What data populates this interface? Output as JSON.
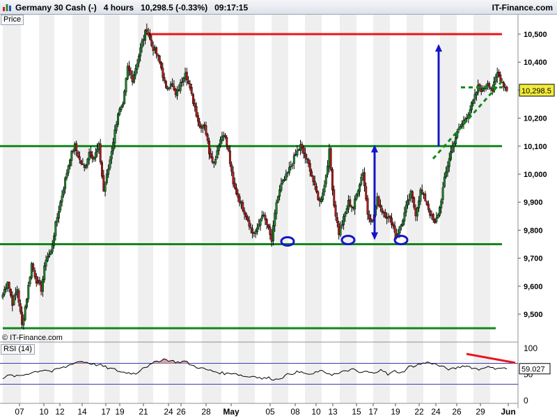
{
  "header": {
    "title": "Germany 30 Cash (-)   4 hours   10,298.5 (-0.33%)   09:17:15",
    "brand": "IT-Finance.com",
    "logo_icon": "chart-bars-icon"
  },
  "panels": {
    "price_label": "Price",
    "rsi_label": "RSI (14)",
    "copyright": "© IT-Finance.com"
  },
  "chart_data": [
    {
      "type": "candlestick",
      "title": "Germany 30 Cash (-)",
      "timeframe": "4 hours",
      "last_price": "10,298.5",
      "change": "-0.33%",
      "time": "09:17:15",
      "y_ticks": [
        "10,500",
        "10,400",
        "10,300",
        "10,200",
        "10,100",
        "10,000",
        "9,900",
        "9,800",
        "9,700",
        "9,600",
        "9,500"
      ],
      "y_tick_values": [
        10500,
        10400,
        10300,
        10200,
        10100,
        10000,
        9900,
        9800,
        9700,
        9600,
        9500
      ],
      "ylim": [
        9440,
        10560
      ],
      "x_ticks": [
        "07",
        "10",
        "12",
        "14",
        "17",
        "19",
        "21",
        "24",
        "26",
        "28",
        "May",
        "05",
        "08",
        "10",
        "13",
        "15",
        "17",
        "19",
        "22",
        "24",
        "26",
        "29",
        "Jun"
      ],
      "last_price_label": "10,298.5",
      "close_path": [
        9570,
        9620,
        9540,
        9590,
        9460,
        9560,
        9680,
        9620,
        9590,
        9700,
        9720,
        9820,
        9900,
        9980,
        10060,
        10100,
        10050,
        10020,
        10080,
        10060,
        10100,
        9940,
        10020,
        10120,
        10220,
        10240,
        10380,
        10340,
        10400,
        10470,
        10520,
        10460,
        10430,
        10380,
        10300,
        10330,
        10280,
        10320,
        10370,
        10300,
        10240,
        10170,
        10180,
        10080,
        10040,
        10110,
        10150,
        10080,
        9960,
        9920,
        9880,
        9840,
        9790,
        9800,
        9860,
        9820,
        9760,
        9900,
        9960,
        9990,
        10030,
        10070,
        10100,
        10060,
        10020,
        9950,
        9900,
        9960,
        10080,
        9890,
        9790,
        9840,
        9900,
        9880,
        9950,
        10010,
        9860,
        9830,
        9910,
        9870,
        9850,
        9830,
        9780,
        9820,
        9880,
        9930,
        9860,
        9940,
        9910,
        9860,
        9820,
        9880,
        9980,
        10060,
        10120,
        10160,
        10190,
        10220,
        10260,
        10310,
        10300,
        10330,
        10300,
        10360,
        10330,
        10298.5
      ],
      "horizontal_levels": [
        {
          "value": 10500,
          "color": "#e8161b",
          "style": "resistance"
        },
        {
          "value": 10100,
          "color": "#12861c",
          "style": "support"
        },
        {
          "value": 9750,
          "color": "#12861c",
          "style": "support"
        },
        {
          "value": 9450,
          "color": "#12861c",
          "style": "support"
        }
      ],
      "annotations": [
        {
          "kind": "up-arrow",
          "from": 10100,
          "to": 10460,
          "color": "#1515c8"
        },
        {
          "kind": "double-arrow",
          "from": 9770,
          "to": 10100,
          "color": "#1515c8"
        },
        {
          "kind": "circle",
          "value": 9760,
          "color": "#1515c8"
        },
        {
          "kind": "circle",
          "value": 9765,
          "color": "#1515c8"
        },
        {
          "kind": "circle",
          "value": 9765,
          "color": "#1515c8"
        },
        {
          "kind": "dashed-trendline",
          "from": 10055,
          "to": 10335,
          "color": "#12861c"
        }
      ]
    },
    {
      "type": "line",
      "title": "RSI (14)",
      "y_ticks": [
        "100",
        "50",
        "0"
      ],
      "y_tick_values": [
        100,
        50,
        0
      ],
      "ylim": [
        0,
        100
      ],
      "levels": [
        70,
        30
      ],
      "last_value_label": "59.027",
      "values": [
        42,
        47,
        45,
        48,
        52,
        55,
        58,
        54,
        60,
        63,
        70,
        74,
        72,
        68,
        66,
        61,
        58,
        53,
        52,
        50,
        62,
        66,
        74,
        78,
        75,
        72,
        74,
        66,
        62,
        58,
        55,
        52,
        50,
        52,
        47,
        44,
        46,
        41,
        42,
        39,
        44,
        50,
        53,
        52,
        47,
        55,
        53,
        49,
        50,
        56,
        58,
        52,
        54,
        50,
        60,
        48,
        55,
        52,
        63,
        66,
        70,
        72,
        67,
        62,
        58,
        62,
        66,
        62,
        58,
        64,
        60,
        62,
        59.027
      ],
      "trendline": {
        "from": 88,
        "to": 71,
        "color": "#e8161b"
      }
    }
  ]
}
